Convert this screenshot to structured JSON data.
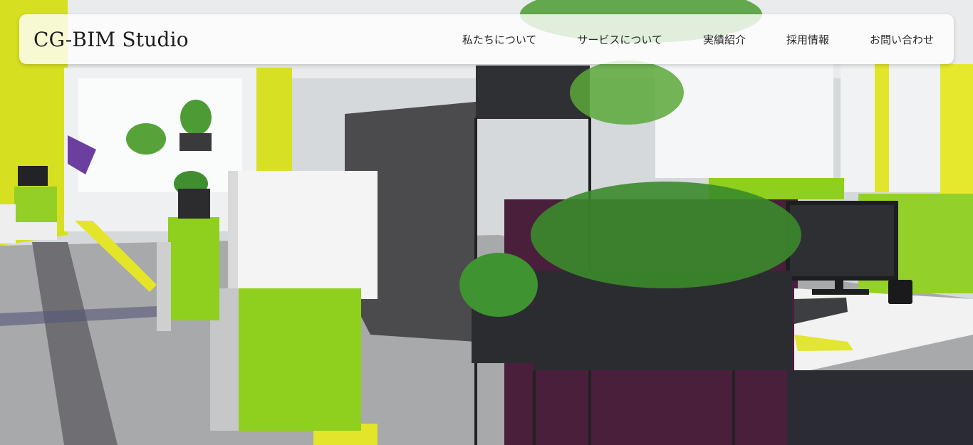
{
  "header": {
    "logo": "CG-BIM Studio",
    "nav": [
      {
        "label": "私たちについて"
      },
      {
        "label": "サービスについて"
      },
      {
        "label": "実績紹介"
      },
      {
        "label": "採用情報"
      },
      {
        "label": "お問い合わせ"
      }
    ]
  },
  "hero": {
    "subject": "modern open-plan office interior",
    "colors": {
      "accent_green": "#8fcf1d",
      "accent_yellow": "#e3e829",
      "partition_purple": "#4a1f3c",
      "floor_grey": "#8c8c8c"
    }
  }
}
